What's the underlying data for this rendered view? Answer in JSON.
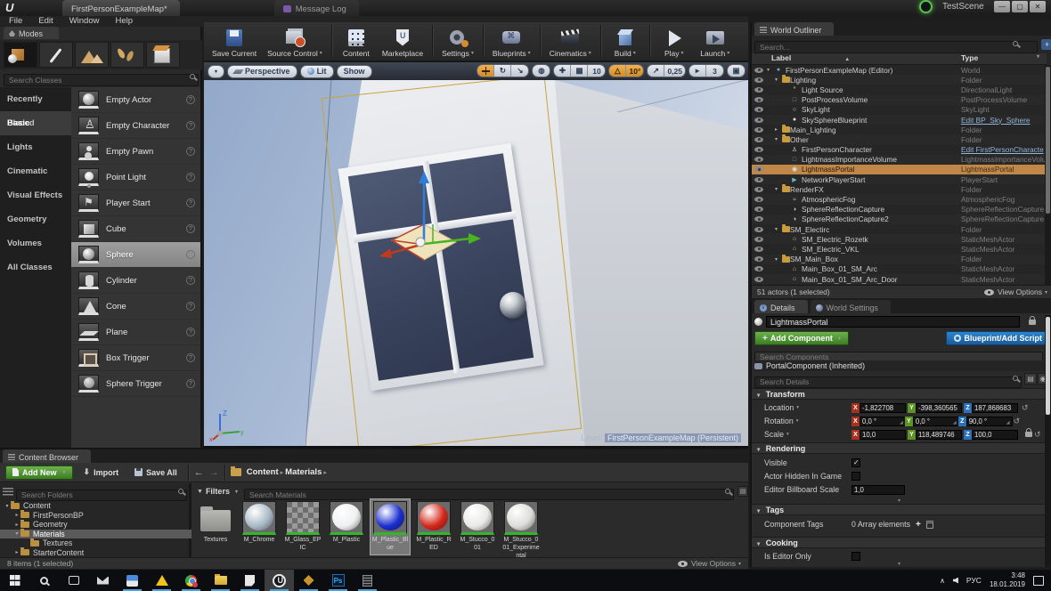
{
  "titlebar": {
    "app_tabs": [
      "FirstPersonExampleMap*",
      "Message Log"
    ],
    "overlay_label": "TestScene",
    "window_buttons": [
      "minimize",
      "maximize",
      "close"
    ]
  },
  "menubar": {
    "items": [
      "File",
      "Edit",
      "Window",
      "Help"
    ]
  },
  "modes": {
    "tab_title": "Modes",
    "search_placeholder": "Search Classes",
    "tools": [
      "place",
      "paint",
      "landscape",
      "foliage",
      "geometry"
    ],
    "active_tool": "place",
    "categories": [
      "Recently Placed",
      "Basic",
      "Lights",
      "Cinematic",
      "Visual Effects",
      "Geometry",
      "Volumes",
      "All Classes"
    ],
    "active_category": "Basic",
    "items": [
      {
        "label": "Empty Actor",
        "icon": "sphere"
      },
      {
        "label": "Empty Character",
        "icon": "character"
      },
      {
        "label": "Empty Pawn",
        "icon": "pawn"
      },
      {
        "label": "Point Light",
        "icon": "bulb"
      },
      {
        "label": "Player Start",
        "icon": "player-start"
      },
      {
        "label": "Cube",
        "icon": "cube"
      },
      {
        "label": "Sphere",
        "icon": "sphere2"
      },
      {
        "label": "Cylinder",
        "icon": "cylinder"
      },
      {
        "label": "Cone",
        "icon": "cone"
      },
      {
        "label": "Plane",
        "icon": "plane"
      },
      {
        "label": "Box Trigger",
        "icon": "box-trigger"
      },
      {
        "label": "Sphere Trigger",
        "icon": "sphere-trigger"
      }
    ],
    "selected_item": "Sphere"
  },
  "main_toolbar": {
    "buttons": [
      {
        "label": "Save Current",
        "dropdown": false,
        "sep_after": false
      },
      {
        "label": "Source Control",
        "dropdown": true,
        "sep_after": true
      },
      {
        "label": "Content",
        "dropdown": false,
        "sep_after": false
      },
      {
        "label": "Marketplace",
        "dropdown": false,
        "sep_after": true
      },
      {
        "label": "Settings",
        "dropdown": true,
        "sep_after": true
      },
      {
        "label": "Blueprints",
        "dropdown": true,
        "sep_after": true
      },
      {
        "label": "Cinematics",
        "dropdown": true,
        "sep_after": true
      },
      {
        "label": "Build",
        "dropdown": true,
        "sep_after": true
      },
      {
        "label": "Play",
        "dropdown": true,
        "sep_after": false
      },
      {
        "label": "Launch",
        "dropdown": true,
        "sep_after": false
      }
    ]
  },
  "viewport": {
    "view_mode": "Perspective",
    "lighting_mode": "Lit",
    "show_label": "Show",
    "grid_snap_value": "10",
    "rotation_snap_value": "10°",
    "scale_snap_value": "0,25",
    "camera_speed_value": "3",
    "axis_z": "Z",
    "axis_y": "y",
    "axis_x": "x",
    "level_label": "Level:",
    "level_value": "FirstPersonExampleMap (Persistent)"
  },
  "outliner": {
    "tab_title": "World Outliner",
    "search_placeholder": "Search...",
    "col_label": "Label",
    "col_type": "Type",
    "rows": [
      {
        "label": "FirstPersonExampleMap (Editor)",
        "type": "World",
        "indent": 0,
        "icon": "world",
        "arrow": "expanded"
      },
      {
        "label": "Lighting",
        "type": "Folder",
        "indent": 1,
        "icon": "folder",
        "arrow": "expanded"
      },
      {
        "label": "Light Source",
        "type": "DirectionalLight",
        "indent": 2,
        "icon": "directional-light"
      },
      {
        "label": "PostProcessVolume",
        "type": "PostProcessVolume",
        "indent": 2,
        "icon": "volume"
      },
      {
        "label": "SkyLight",
        "type": "SkyLight",
        "indent": 2,
        "icon": "skylight"
      },
      {
        "label": "SkySphereBlueprint",
        "type": "Edit BP_Sky_Sphere",
        "indent": 2,
        "icon": "blueprint-sphere",
        "link": true
      },
      {
        "label": "Main_Lighting",
        "type": "Folder",
        "indent": 1,
        "icon": "folder",
        "arrow": "collapsed"
      },
      {
        "label": "Other",
        "type": "Folder",
        "indent": 1,
        "icon": "folder",
        "arrow": "expanded"
      },
      {
        "label": "FirstPersonCharacter",
        "type": "Edit FirstPersonCharacte",
        "indent": 2,
        "icon": "character",
        "link": true
      },
      {
        "label": "LightmassImportanceVolume",
        "type": "LightmassImportanceVolu",
        "indent": 2,
        "icon": "volume"
      },
      {
        "label": "LightmassPortal",
        "type": "LightmassPortal",
        "indent": 2,
        "icon": "portal",
        "selected": true
      },
      {
        "label": "NetworkPlayerStart",
        "type": "PlayerStart",
        "indent": 2,
        "icon": "player-start"
      },
      {
        "label": "RenderFX",
        "type": "Folder",
        "indent": 1,
        "icon": "folder",
        "arrow": "expanded"
      },
      {
        "label": "AtmosphericFog",
        "type": "AtmosphericFog",
        "indent": 2,
        "icon": "fog"
      },
      {
        "label": "SphereReflectionCapture",
        "type": "SphereReflectionCapture",
        "indent": 2,
        "icon": "reflection"
      },
      {
        "label": "SphereReflectionCapture2",
        "type": "SphereReflectionCapture",
        "indent": 2,
        "icon": "reflection"
      },
      {
        "label": "SM_Electirc",
        "type": "Folder",
        "indent": 1,
        "icon": "folder",
        "arrow": "expanded"
      },
      {
        "label": "SM_Electric_Rozetk",
        "type": "StaticMeshActor",
        "indent": 2,
        "icon": "static-mesh"
      },
      {
        "label": "SM_Electric_VKL",
        "type": "StaticMeshActor",
        "indent": 2,
        "icon": "static-mesh"
      },
      {
        "label": "SM_Main_Box",
        "type": "Folder",
        "indent": 1,
        "icon": "folder",
        "arrow": "expanded"
      },
      {
        "label": "Main_Box_01_SM_Arc",
        "type": "StaticMeshActor",
        "indent": 2,
        "icon": "static-mesh"
      },
      {
        "label": "Main_Box_01_SM_Arc_Door",
        "type": "StaticMeshActor",
        "indent": 2,
        "icon": "static-mesh"
      }
    ],
    "status": "51 actors (1 selected)",
    "view_options_label": "View Options"
  },
  "details": {
    "tab_details": "Details",
    "tab_world_settings": "World Settings",
    "actor_name": "LightmassPortal",
    "add_component_label": "Add Component",
    "blueprint_label": "Blueprint/Add Script",
    "search_components_placeholder": "Search Components",
    "component_item": "PortalComponent (Inherited)",
    "search_details_placeholder": "Search Details",
    "axes": [
      "X",
      "Y",
      "Z"
    ],
    "transform": {
      "section": "Transform",
      "rows": [
        {
          "label": "Location",
          "x": "-1,822708",
          "y": "-398,360565",
          "z": "187,868683",
          "drag": false,
          "lock": false
        },
        {
          "label": "Rotation",
          "x": "0,0 °",
          "y": "0,0 °",
          "z": "90,0 °",
          "drag": true,
          "lock": false
        },
        {
          "label": "Scale",
          "x": "10,0",
          "y": "118,489746",
          "z": "100,0",
          "drag": false,
          "lock": true
        }
      ]
    },
    "rendering": {
      "section": "Rendering",
      "visible_label": "Visible",
      "visible_checked": true,
      "hidden_label": "Actor Hidden In Game",
      "hidden_checked": false,
      "billboard_label": "Editor Billboard Scale",
      "billboard_value": "1,0"
    },
    "tags": {
      "section": "Tags",
      "row_label": "Component Tags",
      "row_value": "0 Array elements"
    },
    "cooking": {
      "section": "Cooking",
      "row_label": "Is Editor Only",
      "checked": false
    }
  },
  "content_browser": {
    "tab_title": "Content Browser",
    "add_new_label": "Add New",
    "import_label": "Import",
    "save_all_label": "Save All",
    "breadcrumbs": [
      "Content",
      "Materials"
    ],
    "search_folders_placeholder": "Search Folders",
    "folders": [
      {
        "label": "Content",
        "indent": 0,
        "arrow": "expanded"
      },
      {
        "label": "FirstPersonBP",
        "indent": 1,
        "arrow": "collapsed"
      },
      {
        "label": "Geometry",
        "indent": 1,
        "arrow": "collapsed"
      },
      {
        "label": "Materials",
        "indent": 1,
        "arrow": "expanded",
        "selected": true
      },
      {
        "label": "Textures",
        "indent": 2,
        "arrow": "none"
      },
      {
        "label": "StarterContent",
        "indent": 1,
        "arrow": "collapsed"
      }
    ],
    "filters_label": "Filters",
    "search_assets_placeholder": "Search Materials",
    "assets": [
      {
        "name": "Textures",
        "kind": "folder"
      },
      {
        "name": "M_Chrome",
        "kind": "sphere",
        "color": "#a9bac6"
      },
      {
        "name": "M_Glass_EPIC",
        "kind": "checker"
      },
      {
        "name": "M_Plastic",
        "kind": "sphere",
        "color": "#eef0f2"
      },
      {
        "name": "M_Plastic_Blue",
        "kind": "sphere",
        "color": "#1d2fd0",
        "selected": true
      },
      {
        "name": "M_Plastic_RED",
        "kind": "sphere",
        "color": "#d6281c"
      },
      {
        "name": "M_Stucco_001",
        "kind": "sphere",
        "color": "#e9eae6"
      },
      {
        "name": "M_Stucco_001_Experimental",
        "kind": "sphere",
        "color": "#dcdcd8"
      }
    ],
    "status": "8 items (1 selected)",
    "view_options_label": "View Options"
  },
  "taskbar": {
    "icons": [
      {
        "name": "start",
        "running": false
      },
      {
        "name": "search",
        "running": false
      },
      {
        "name": "taskview",
        "running": false
      },
      {
        "name": "mail",
        "running": false
      },
      {
        "name": "media",
        "running": true
      },
      {
        "name": "adaware",
        "running": true
      },
      {
        "name": "chrome",
        "running": true
      },
      {
        "name": "folder",
        "running": true
      },
      {
        "name": "notepad",
        "running": true
      },
      {
        "name": "unreal",
        "running": true,
        "active": true
      },
      {
        "name": "xapp",
        "running": true
      },
      {
        "name": "ps",
        "running": true,
        "glyph": "Ps"
      },
      {
        "name": "calc",
        "running": true
      }
    ],
    "tray": {
      "hidden_icons": "∧",
      "language": "РУС",
      "time": "3:48",
      "date": "18.01.2019"
    }
  }
}
